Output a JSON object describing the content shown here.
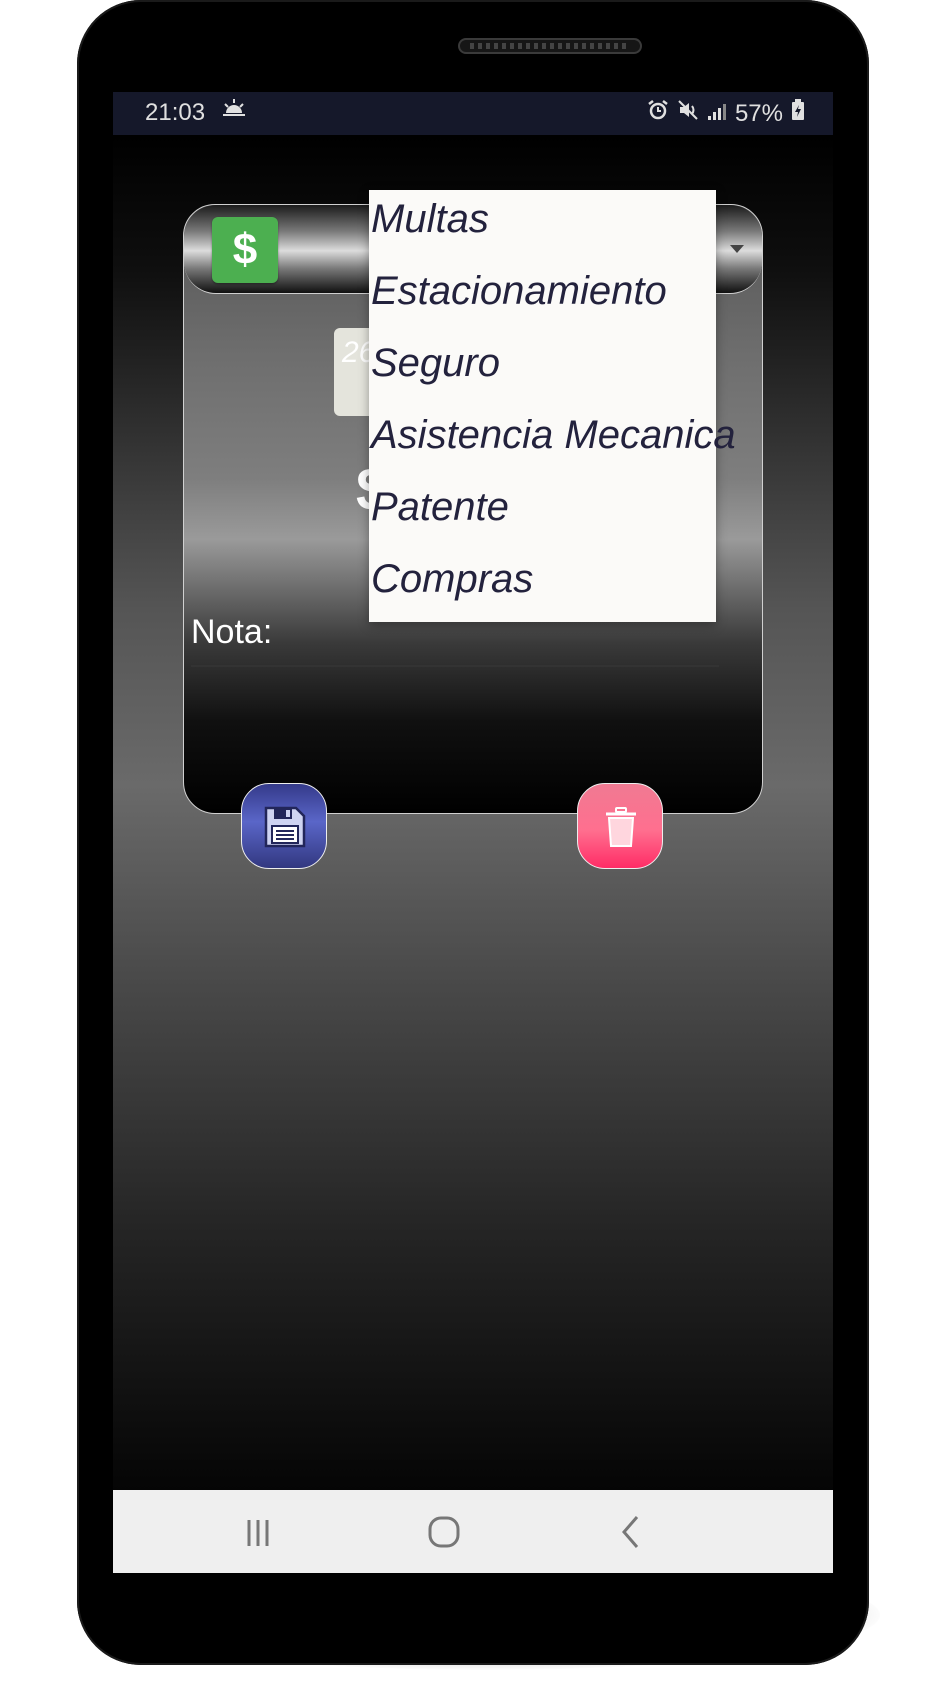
{
  "status_bar": {
    "time": "21:03",
    "battery": "57%",
    "icons": [
      "weather-icon",
      "alarm-icon",
      "mute-icon",
      "signal-icon",
      "battery-icon"
    ]
  },
  "card": {
    "header_icon": "dollar-icon",
    "date_partial": "26",
    "amount_partial": "$",
    "nota_label": "Nota:"
  },
  "dropdown": {
    "items": [
      "Multas",
      "Estacionamiento",
      "Seguro",
      "Asistencia Mecanica",
      "Patente",
      "Compras"
    ]
  },
  "buttons": {
    "save_icon": "floppy-disk-icon",
    "delete_icon": "trash-icon"
  },
  "colors": {
    "dollar_bg": "#4caf50",
    "save_button": "#4a55b5",
    "delete_button": "#ff4f7a",
    "status_bar_bg": "#15182a",
    "dropdown_text": "#23223d"
  }
}
